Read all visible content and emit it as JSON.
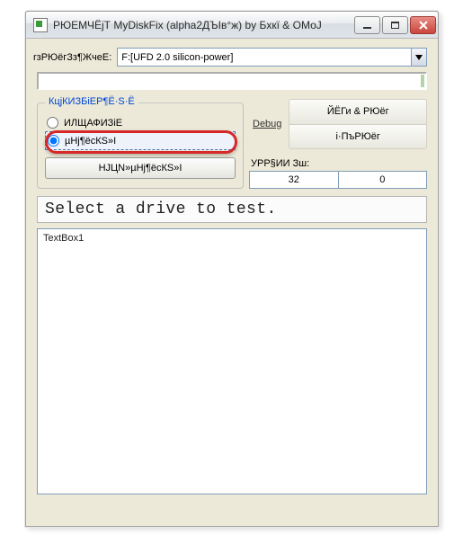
{
  "window": {
    "title": "РЮЕМЧЁјТ MyDiskFix (alpha2ДЪІв°ж) by Бхкї & ОМоЈ",
    "icon": "app-icon"
  },
  "drive": {
    "label": "rзРЮёгЗз¶ЖчеЕ:",
    "selected": "F:[UFD 2.0 silicon-power]"
  },
  "group": {
    "title": "КцјКИЗБіЕР¶Ё·Ѕ·Ё",
    "radio1": "ИЛЩАФИЗіЕ",
    "radio2": "µНј¶ёсКЅ»І",
    "button": "НЈЦN»µНј¶ёсКЅ»І"
  },
  "right": {
    "debug_link": "Debug",
    "btn1": "ЙЁГи & РЮёг",
    "btn2": "і·ПъРЮёг",
    "stat_label": "УРР§ИИ Зш:",
    "stat_val1": "32",
    "stat_val2": "0"
  },
  "message": "Select a drive to test.",
  "textarea": "TextBox1"
}
